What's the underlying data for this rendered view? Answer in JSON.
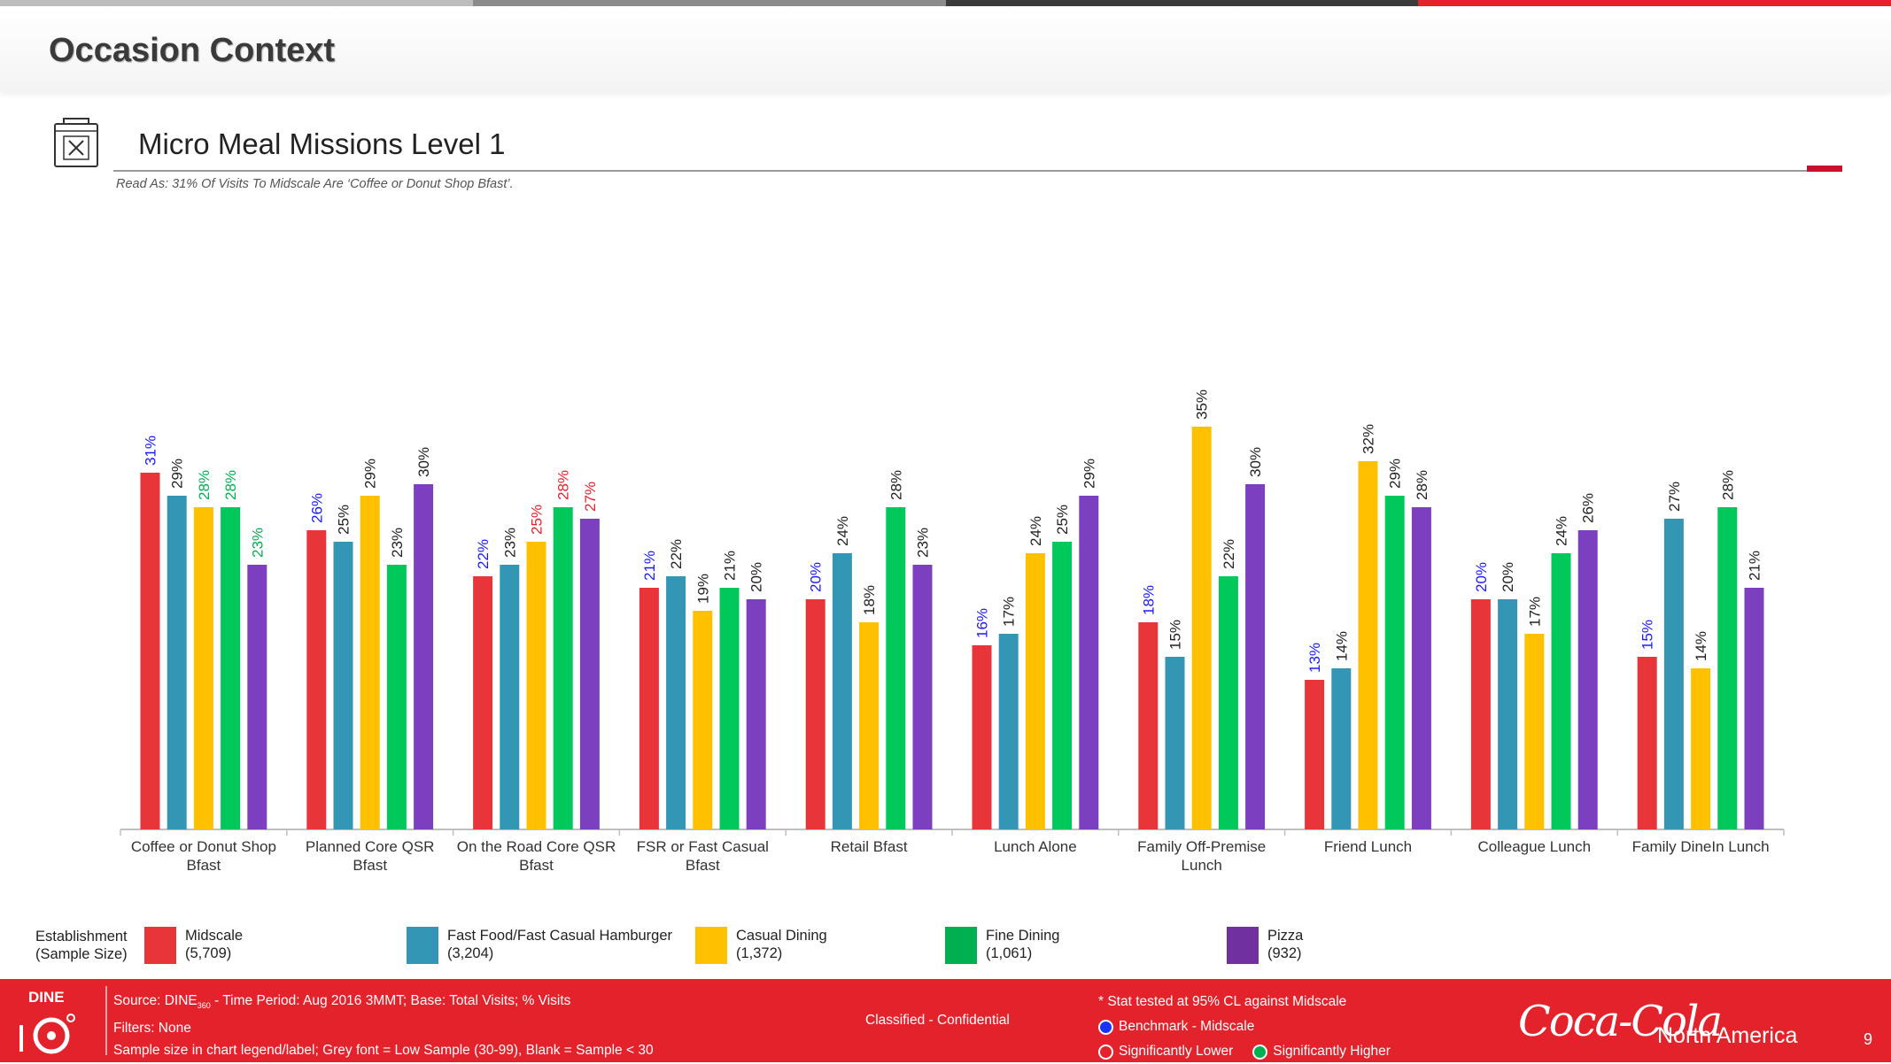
{
  "page": {
    "title": "Occasion Context",
    "section_title": "Micro Meal Missions Level 1",
    "read_as": "Read As: 31% Of Visits To Midscale Are ‘Coffee or Donut Shop Bfast’.",
    "section_icon": "takeout-bag-icon",
    "topbar_colors": [
      "#bdbdbd",
      "#8c8c8c",
      "#3b3b3b",
      "#e4222b"
    ],
    "accent_color": "#c8102e"
  },
  "chart_data": {
    "type": "bar",
    "ylim": [
      0,
      40
    ],
    "grid": false,
    "categories": [
      [
        "Coffee or Donut Shop",
        "Bfast"
      ],
      [
        "Planned Core QSR",
        "Bfast"
      ],
      [
        "On the Road Core QSR",
        "Bfast"
      ],
      [
        "FSR or Fast Casual",
        "Bfast"
      ],
      [
        "Retail Bfast"
      ],
      [
        "Lunch Alone"
      ],
      [
        "Family Off-Premise",
        "Lunch"
      ],
      [
        "Friend Lunch"
      ],
      [
        "Colleague Lunch"
      ],
      [
        "Family DineIn Lunch"
      ]
    ],
    "series": [
      {
        "name": "Midscale",
        "color": "#e8353a",
        "values": [
          31,
          26,
          22,
          21,
          20,
          16,
          18,
          13,
          20,
          15
        ]
      },
      {
        "name": "Fast Food/Fast Casual Hamburger",
        "color": "#3396b5",
        "values": [
          29,
          25,
          23,
          22,
          24,
          17,
          15,
          14,
          20,
          27
        ]
      },
      {
        "name": "Casual Dining",
        "color": "#ffc000",
        "values": [
          28,
          29,
          25,
          19,
          18,
          24,
          35,
          32,
          17,
          14
        ]
      },
      {
        "name": "Fine Dining",
        "color": "#00c85a",
        "values": [
          28,
          23,
          28,
          21,
          28,
          25,
          22,
          29,
          24,
          28
        ]
      },
      {
        "name": "Pizza",
        "color": "#7c3fbf",
        "values": [
          23,
          30,
          27,
          20,
          23,
          29,
          30,
          28,
          26,
          21
        ]
      }
    ],
    "labels": [
      [
        "31%",
        "26%",
        "22%",
        "21%",
        "20%",
        "16%",
        "18%",
        "13%",
        "20%",
        "15%"
      ],
      [
        "29%",
        "25%",
        "23%",
        "22%",
        "24%",
        "17%",
        "15%",
        "14%",
        "20%",
        "27%"
      ],
      [
        "28%",
        "29%",
        "25%",
        "19%",
        "18%",
        "24%",
        "35%",
        "32%",
        "17%",
        "14%"
      ],
      [
        "28%",
        "23%",
        "28%",
        "21%",
        "28%",
        "25%",
        "22%",
        "29%",
        "24%",
        "28%"
      ],
      [
        "23%",
        "30%",
        "27%",
        "20%",
        "23%",
        "29%",
        "30%",
        "28%",
        "26%",
        "21%"
      ]
    ],
    "label_colors": [
      [
        "#1a1aff",
        "#1a1aff",
        "#1a1aff",
        "#1a1aff",
        "#1a1aff",
        "#1a1aff",
        "#1a1aff",
        "#1a1aff",
        "#1a1aff",
        "#1a1aff"
      ],
      [
        "#222222",
        "#222222",
        "#222222",
        "#222222",
        "#222222",
        "#222222",
        "#222222",
        "#222222",
        "#222222",
        "#222222"
      ],
      [
        "#00b050",
        "#222222",
        "#e8202a",
        "#222222",
        "#222222",
        "#222222",
        "#222222",
        "#222222",
        "#222222",
        "#222222"
      ],
      [
        "#00b050",
        "#222222",
        "#e8202a",
        "#222222",
        "#222222",
        "#222222",
        "#222222",
        "#222222",
        "#222222",
        "#222222"
      ],
      [
        "#00b050",
        "#222222",
        "#e8202a",
        "#222222",
        "#222222",
        "#222222",
        "#222222",
        "#222222",
        "#222222",
        "#222222"
      ]
    ]
  },
  "legend": {
    "title": [
      "Establishment",
      "(Sample Size)"
    ],
    "items": [
      {
        "name": "Midscale",
        "n": "(5,709)",
        "color": "#e8353a"
      },
      {
        "name": "Fast Food/Fast Casual Hamburger",
        "n": "(3,204)",
        "color": "#3396b5"
      },
      {
        "name": "Casual Dining",
        "n": "(1,372)",
        "color": "#ffc000"
      },
      {
        "name": "Fine Dining",
        "n": "(1,061)",
        "color": "#00c85a"
      },
      {
        "name": "Pizza",
        "n": "(932)",
        "color": "#7c3fbf"
      }
    ]
  },
  "footer": {
    "background": "#e4222b",
    "source_prefix": "Source: DINE",
    "source_sub": "360",
    "source_rest": " - Time Period: Aug 2016 3MMT; Base: Total Visits; % Visits",
    "filters": "Filters: None",
    "sample_note": "Sample size in chart legend/label;  Grey font = Low Sample (30-99), Blank = Sample < 30",
    "classification": "Classified - Confidential",
    "stat_title": "* Stat tested at 95% CL against Midscale",
    "benchmark": "Benchmark - Midscale",
    "sig_lower": "Significantly Lower",
    "sig_higher": "Significantly Higher",
    "dine_logo_text": "DINE",
    "brand": "Coca-Cola",
    "brand_sub": "North America",
    "page_number": "9"
  }
}
